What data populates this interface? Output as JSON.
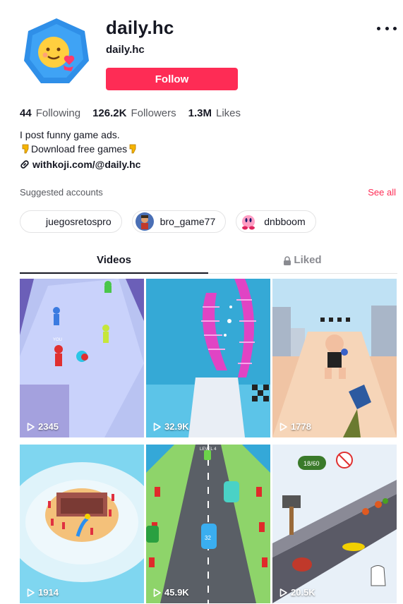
{
  "profile": {
    "username": "daily.hc",
    "nickname": "daily.hc",
    "follow_label": "Follow"
  },
  "stats": [
    {
      "value": "44",
      "label": "Following"
    },
    {
      "value": "126.2K",
      "label": "Followers"
    },
    {
      "value": "1.3M",
      "label": "Likes"
    }
  ],
  "bio": {
    "line1": "I post funny game ads.",
    "line2": "Download free games",
    "link": "withkoji.com/@daily.hc"
  },
  "suggested": {
    "title": "Suggested accounts",
    "see_all": "See all",
    "accounts": [
      {
        "name": "juegosretospro"
      },
      {
        "name": "bro_game77"
      },
      {
        "name": "dnbboom"
      }
    ]
  },
  "tabs": [
    {
      "label": "Videos"
    },
    {
      "label": "Liked"
    }
  ],
  "videos": [
    {
      "views": "2345"
    },
    {
      "views": "32.9K"
    },
    {
      "views": "1778"
    },
    {
      "views": "1914"
    },
    {
      "views": "45.9K"
    },
    {
      "views": "20.5K"
    }
  ],
  "colors": {
    "accent": "#fe2c55",
    "text": "#161823",
    "secondary": "#57595f"
  }
}
